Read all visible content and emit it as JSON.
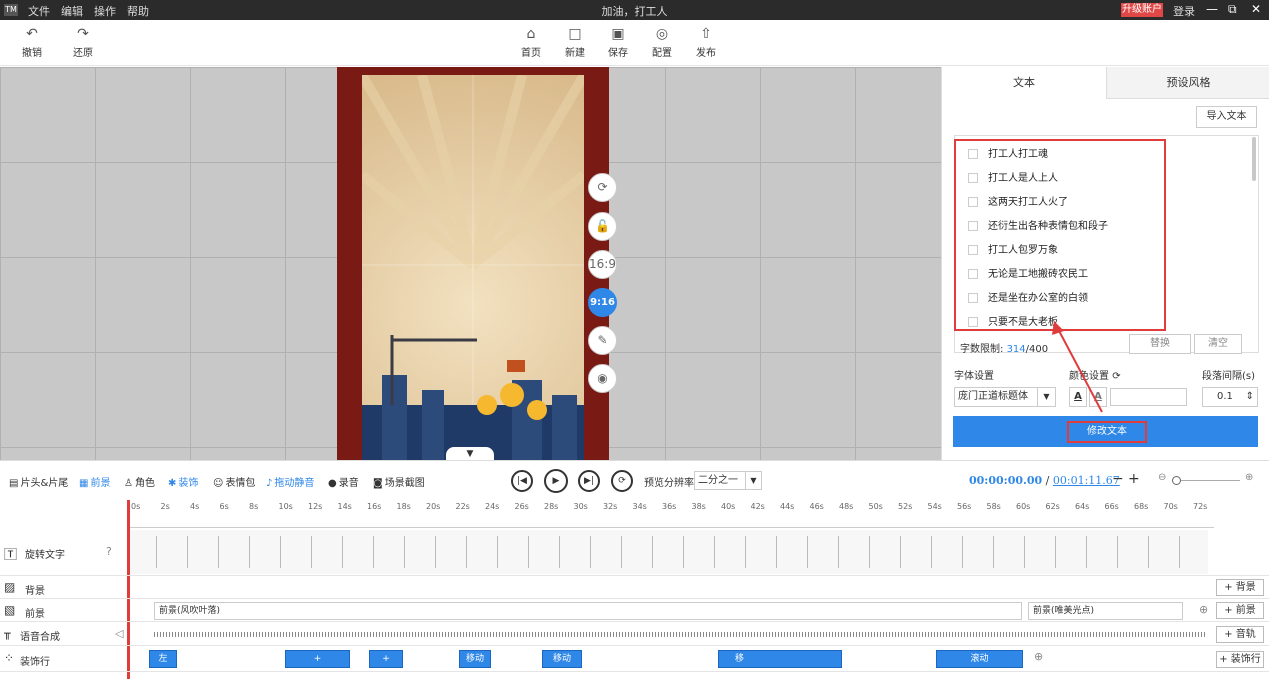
{
  "titlebar": {
    "logo": "TM",
    "menus": [
      "文件",
      "编辑",
      "操作",
      "帮助"
    ],
    "title": "加油，打工人",
    "upgrade": "升级账户",
    "login": "登录",
    "controls": [
      "—",
      "⧉",
      "✕"
    ]
  },
  "toolbar": {
    "undo": "撤销",
    "redo": "还原",
    "home": "首页",
    "new": "新建",
    "save": "保存",
    "config": "配置",
    "publish": "发布"
  },
  "canvas_controls": {
    "ratio_169": "16:9",
    "ratio_916": "9:16"
  },
  "panel": {
    "tabs": [
      "文本",
      "预设风格"
    ],
    "import": "导入文本",
    "lines": [
      "打工人打工魂",
      "打工人是人上人",
      "这两天打工人火了",
      "还衍生出各种表情包和段子",
      "打工人包罗万象",
      "无论是工地搬砖农民工",
      "还是坐在办公室的白领",
      "只要不是大老板"
    ],
    "char_limit_label": "字数限制: ",
    "char_count": "314",
    "char_max": "/400",
    "replace": "替换",
    "clear": "清空",
    "font_label": "字体设置",
    "color_label": "颜色设置",
    "spacing_label": "段落间隔(s)",
    "font_value": "庞门正道标题体",
    "spacing_value": "0.1",
    "modify": "修改文本",
    "accent": "#2f87e8",
    "highlight": "#e03c3c"
  },
  "bottom": {
    "tools": [
      "片头&片尾",
      "前景",
      "角色",
      "装饰",
      "表情包",
      "拖动静音",
      "录音",
      "场景截图"
    ],
    "resolution_label": "预览分辨率",
    "resolution_value": "二分之一",
    "time_current": "00:00:00.00",
    "time_sep": " / ",
    "time_total": "00:01:11.67"
  },
  "timeline": {
    "ticks": [
      "0s",
      "2s",
      "4s",
      "6s",
      "8s",
      "10s",
      "12s",
      "14s",
      "16s",
      "18s",
      "20s",
      "22s",
      "24s",
      "26s",
      "28s",
      "30s",
      "32s",
      "34s",
      "36s",
      "38s",
      "40s",
      "42s",
      "44s",
      "46s",
      "48s",
      "50s",
      "52s",
      "54s",
      "56s",
      "58s",
      "60s",
      "62s",
      "64s",
      "66s",
      "68s",
      "70s",
      "72s"
    ],
    "tracks": [
      "旋转文字",
      "背景",
      "前景",
      "语音合成",
      "装饰行"
    ],
    "fg_seg1": "前景(风吹叶落)",
    "fg_seg2": "前景(唯美光点)",
    "deco_segs": [
      "左",
      "移动",
      "移动",
      "移",
      "滚动"
    ],
    "add_bg": "+ 背景",
    "add_fg": "+ 前景",
    "add_audio": "+ 音轨",
    "add_deco": "+ 装饰行"
  }
}
